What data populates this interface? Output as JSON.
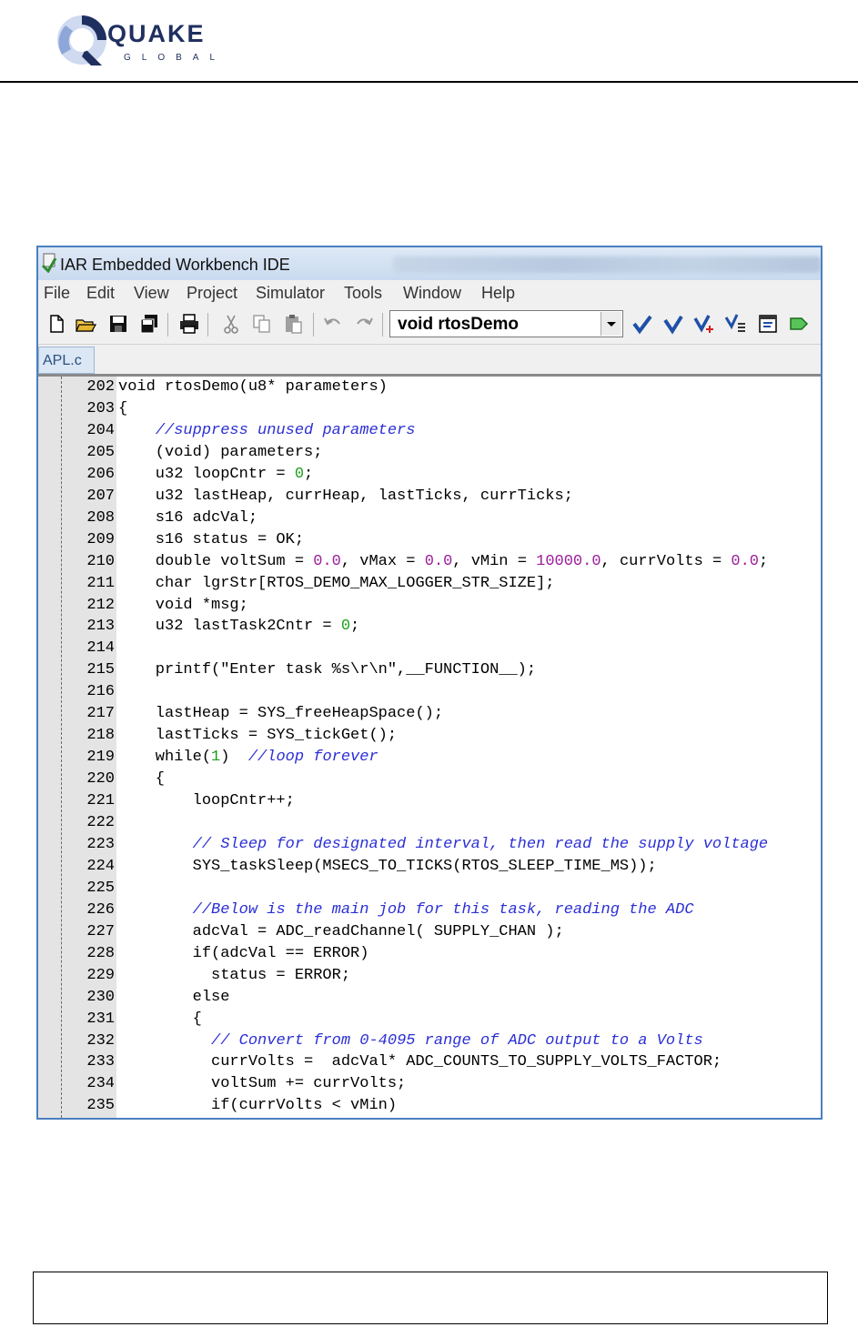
{
  "logo": {
    "word": "QUAKE",
    "sub": "GLOBAL"
  },
  "window": {
    "title": "IAR Embedded Workbench IDE"
  },
  "menu": [
    "File",
    "Edit",
    "View",
    "Project",
    "Simulator",
    "Tools",
    "Window",
    "Help"
  ],
  "toolbar": {
    "function_combo": "void rtosDemo"
  },
  "tabs": [
    {
      "label": "APL.c"
    }
  ],
  "code_lines": [
    {
      "n": "202",
      "segs": [
        {
          "t": "void rtosDemo(u8* parameters)",
          "k": "code"
        }
      ]
    },
    {
      "n": "203",
      "segs": [
        {
          "t": "{",
          "k": "code"
        }
      ]
    },
    {
      "n": "204",
      "segs": [
        {
          "t": "    ",
          "k": "code"
        },
        {
          "t": "//suppress unused parameters",
          "k": "comment"
        }
      ]
    },
    {
      "n": "205",
      "segs": [
        {
          "t": "    (void) parameters;",
          "k": "code"
        }
      ]
    },
    {
      "n": "206",
      "segs": [
        {
          "t": "    u32 loopCntr = ",
          "k": "code"
        },
        {
          "t": "0",
          "k": "num"
        },
        {
          "t": ";",
          "k": "code"
        }
      ]
    },
    {
      "n": "207",
      "segs": [
        {
          "t": "    u32 lastHeap, currHeap, lastTicks, currTicks;",
          "k": "code"
        }
      ]
    },
    {
      "n": "208",
      "segs": [
        {
          "t": "    s16 adcVal;",
          "k": "code"
        }
      ]
    },
    {
      "n": "209",
      "segs": [
        {
          "t": "    s16 status = OK;",
          "k": "code"
        }
      ]
    },
    {
      "n": "210",
      "segs": [
        {
          "t": "    double voltSum = ",
          "k": "code"
        },
        {
          "t": "0.0",
          "k": "num2"
        },
        {
          "t": ", vMax = ",
          "k": "code"
        },
        {
          "t": "0.0",
          "k": "num2"
        },
        {
          "t": ", vMin = ",
          "k": "code"
        },
        {
          "t": "10000.0",
          "k": "num2"
        },
        {
          "t": ", currVolts = ",
          "k": "code"
        },
        {
          "t": "0.0",
          "k": "num2"
        },
        {
          "t": ";",
          "k": "code"
        }
      ]
    },
    {
      "n": "211",
      "segs": [
        {
          "t": "    char lgrStr[RTOS_DEMO_MAX_LOGGER_STR_SIZE];",
          "k": "code"
        }
      ]
    },
    {
      "n": "212",
      "segs": [
        {
          "t": "    void *msg;",
          "k": "code"
        }
      ]
    },
    {
      "n": "213",
      "segs": [
        {
          "t": "    u32 lastTask2Cntr = ",
          "k": "code"
        },
        {
          "t": "0",
          "k": "num"
        },
        {
          "t": ";",
          "k": "code"
        }
      ]
    },
    {
      "n": "214",
      "segs": [
        {
          "t": "",
          "k": "code"
        }
      ]
    },
    {
      "n": "215",
      "segs": [
        {
          "t": "    printf(\"Enter task %s\\r\\n\",__FUNCTION__);",
          "k": "code"
        }
      ]
    },
    {
      "n": "216",
      "segs": [
        {
          "t": "",
          "k": "code"
        }
      ]
    },
    {
      "n": "217",
      "segs": [
        {
          "t": "    lastHeap = SYS_freeHeapSpace();",
          "k": "code"
        }
      ]
    },
    {
      "n": "218",
      "segs": [
        {
          "t": "    lastTicks = SYS_tickGet();",
          "k": "code"
        }
      ]
    },
    {
      "n": "219",
      "segs": [
        {
          "t": "    while(",
          "k": "code"
        },
        {
          "t": "1",
          "k": "num"
        },
        {
          "t": ")  ",
          "k": "code"
        },
        {
          "t": "//loop forever",
          "k": "comment"
        }
      ]
    },
    {
      "n": "220",
      "segs": [
        {
          "t": "    {",
          "k": "code"
        }
      ]
    },
    {
      "n": "221",
      "segs": [
        {
          "t": "        loopCntr++;",
          "k": "code"
        }
      ]
    },
    {
      "n": "222",
      "segs": [
        {
          "t": "",
          "k": "code"
        }
      ]
    },
    {
      "n": "223",
      "segs": [
        {
          "t": "        ",
          "k": "code"
        },
        {
          "t": "// Sleep for designated interval, then read the supply voltage",
          "k": "comment"
        }
      ]
    },
    {
      "n": "224",
      "segs": [
        {
          "t": "        SYS_taskSleep(MSECS_TO_TICKS(RTOS_SLEEP_TIME_MS));",
          "k": "code"
        }
      ]
    },
    {
      "n": "225",
      "segs": [
        {
          "t": "",
          "k": "code"
        }
      ]
    },
    {
      "n": "226",
      "segs": [
        {
          "t": "        ",
          "k": "code"
        },
        {
          "t": "//Below is the main job for this task, reading the ADC",
          "k": "comment"
        }
      ]
    },
    {
      "n": "227",
      "segs": [
        {
          "t": "        adcVal = ADC_readChannel( SUPPLY_CHAN );",
          "k": "code"
        }
      ]
    },
    {
      "n": "228",
      "segs": [
        {
          "t": "        if(adcVal == ERROR)",
          "k": "code"
        }
      ]
    },
    {
      "n": "229",
      "segs": [
        {
          "t": "          status = ERROR;",
          "k": "code"
        }
      ]
    },
    {
      "n": "230",
      "segs": [
        {
          "t": "        else",
          "k": "code"
        }
      ]
    },
    {
      "n": "231",
      "segs": [
        {
          "t": "        {",
          "k": "code"
        }
      ]
    },
    {
      "n": "232",
      "segs": [
        {
          "t": "          ",
          "k": "code"
        },
        {
          "t": "// Convert from 0-4095 range of ADC output to a Volts",
          "k": "comment"
        }
      ]
    },
    {
      "n": "233",
      "segs": [
        {
          "t": "          currVolts =  adcVal* ADC_COUNTS_TO_SUPPLY_VOLTS_FACTOR;",
          "k": "code"
        }
      ]
    },
    {
      "n": "234",
      "segs": [
        {
          "t": "          voltSum += currVolts;",
          "k": "code"
        }
      ]
    },
    {
      "n": "235",
      "segs": [
        {
          "t": "          if(currVolts < vMin)",
          "k": "code"
        }
      ]
    }
  ],
  "colors": {
    "frame_border": "#4a7fc1",
    "comment": "#2b2fd4",
    "int_literal": "#1aa11a",
    "float_literal": "#9b1e9b"
  }
}
